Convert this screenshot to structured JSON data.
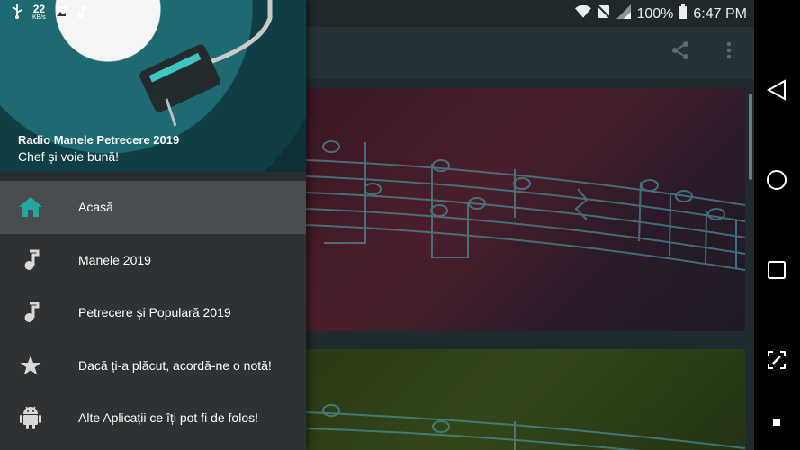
{
  "status_bar": {
    "kbs_value": "22",
    "kbs_unit": "KB/s",
    "battery_percent": "100%",
    "time": "6:47 PM"
  },
  "drawer": {
    "header": {
      "title": "Radio Manele Petrecere 2019",
      "subtitle": "Chef și voie bună!"
    },
    "items": [
      {
        "label": "Acasă",
        "icon": "home-icon",
        "active": true
      },
      {
        "label": "Manele 2019",
        "icon": "music-note-icon",
        "active": false
      },
      {
        "label": "Petrecere și Populară 2019",
        "icon": "music-note-icon",
        "active": false
      },
      {
        "label": "Dacă ți-a plăcut, acordă-ne o notă!",
        "icon": "star-icon",
        "active": false
      },
      {
        "label": "Alte Aplicații ce îți pot fi de folos!",
        "icon": "android-icon",
        "active": false
      }
    ]
  },
  "colors": {
    "accent": "#21a9a0",
    "drawer_bg": "#2f3234",
    "active_item_bg": "#4a4d4f",
    "toolbar_bg": "#263236",
    "status_bg": "#20282b"
  },
  "toolbar": {
    "icons": [
      "share-icon",
      "overflow-menu-icon"
    ]
  },
  "navbar": {
    "icons": [
      "back-icon",
      "home-circle-icon",
      "recents-icon",
      "screenshot-edit-icon",
      "stop-square-icon"
    ]
  }
}
